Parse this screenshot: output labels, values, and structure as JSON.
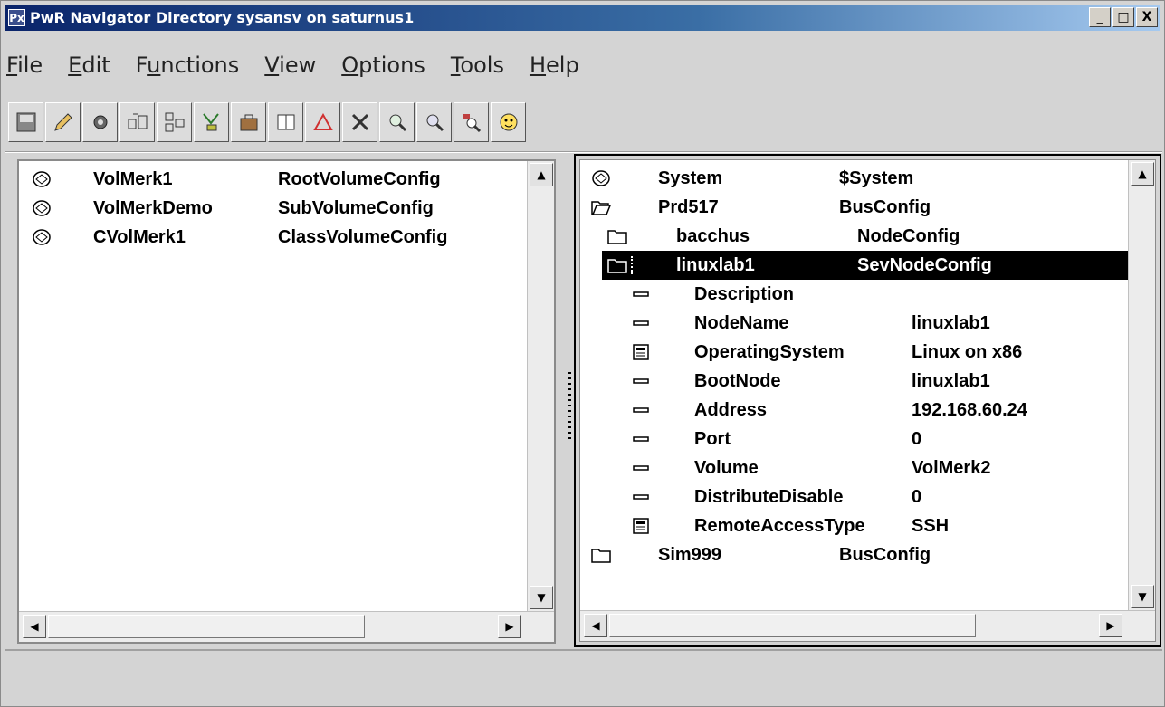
{
  "window": {
    "title": "PwR Navigator Directory sysansv on saturnus1",
    "title_icon": "Px",
    "controls": [
      "_",
      "□",
      "X"
    ]
  },
  "menubar": {
    "items": [
      {
        "pre": "",
        "u": "F",
        "post": "ile"
      },
      {
        "pre": "",
        "u": "E",
        "post": "dit"
      },
      {
        "pre": "F",
        "u": "u",
        "post": "nctions"
      },
      {
        "pre": "",
        "u": "V",
        "post": "iew"
      },
      {
        "pre": "",
        "u": "O",
        "post": "ptions"
      },
      {
        "pre": "",
        "u": "T",
        "post": "ools"
      },
      {
        "pre": "",
        "u": "H",
        "post": "elp"
      }
    ]
  },
  "toolbar": {
    "buttons": [
      "save-icon",
      "pencil-icon",
      "gear-icon",
      "open-object-icon",
      "hierarchy-icon",
      "merge-icon",
      "briefcase-icon",
      "split-window-icon",
      "warning-triangle-icon",
      "tools-icon",
      "zoom-in-icon",
      "zoom-out-icon",
      "zoom-reset-icon",
      "smiley-icon"
    ]
  },
  "left_pane": {
    "rows": [
      {
        "name": "VolMerk1",
        "class": "RootVolumeConfig",
        "icon": "volume-icon"
      },
      {
        "name": "VolMerkDemo",
        "class": "SubVolumeConfig",
        "icon": "volume-icon"
      },
      {
        "name": "CVolMerk1",
        "class": "ClassVolumeConfig",
        "icon": "volume-icon"
      }
    ]
  },
  "right_pane": {
    "rows": [
      {
        "name": "System",
        "class": "$System",
        "icon": "volume-icon",
        "indent": 0
      },
      {
        "name": "Prd517",
        "class": "BusConfig",
        "icon": "open-folder-icon",
        "indent": 0
      },
      {
        "name": "bacchus",
        "class": "NodeConfig",
        "icon": "folder-icon",
        "indent": 1
      },
      {
        "name": "linuxlab1",
        "class": "SevNodeConfig",
        "icon": "folder-icon",
        "indent": 1,
        "selected": true
      },
      {
        "name": "Description",
        "class": "",
        "icon": "attribute-icon",
        "indent": 2
      },
      {
        "name": "NodeName",
        "class": "linuxlab1",
        "icon": "attribute-icon",
        "indent": 2
      },
      {
        "name": "OperatingSystem",
        "class": "Linux on x86",
        "icon": "enum-icon",
        "indent": 2
      },
      {
        "name": "BootNode",
        "class": "linuxlab1",
        "icon": "attribute-icon",
        "indent": 2
      },
      {
        "name": "Address",
        "class": "192.168.60.24",
        "icon": "attribute-icon",
        "indent": 2
      },
      {
        "name": "Port",
        "class": "0",
        "icon": "attribute-icon",
        "indent": 2
      },
      {
        "name": "Volume",
        "class": "VolMerk2",
        "icon": "attribute-icon",
        "indent": 2
      },
      {
        "name": "DistributeDisable",
        "class": "0",
        "icon": "attribute-icon",
        "indent": 2
      },
      {
        "name": "RemoteAccessType",
        "class": "SSH",
        "icon": "enum-icon",
        "indent": 2
      },
      {
        "name": "Sim999",
        "class": "BusConfig",
        "icon": "folder-icon",
        "indent": 0
      }
    ]
  }
}
